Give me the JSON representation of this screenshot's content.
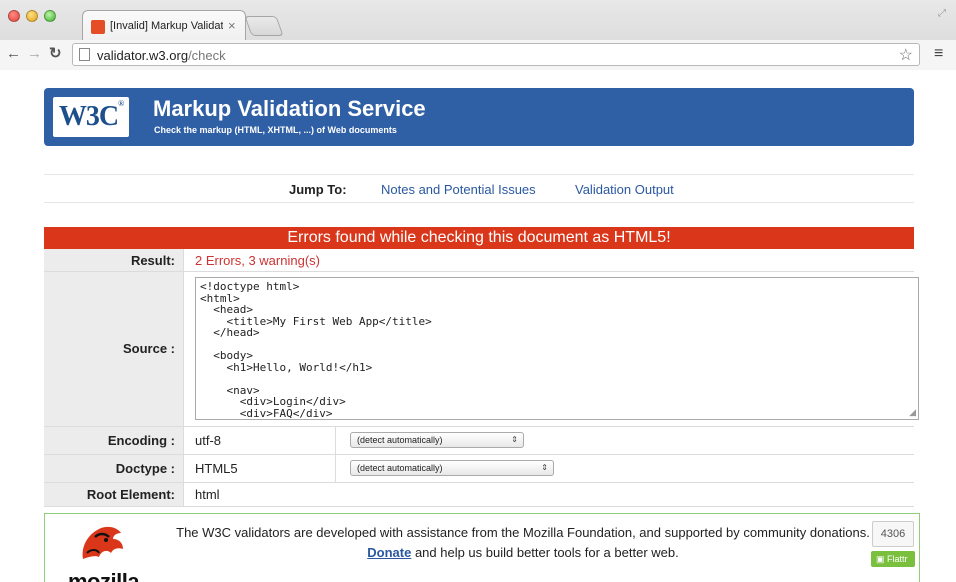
{
  "browser": {
    "tab_title": "[Invalid] Markup Validation",
    "tab_close": "×",
    "url_host": "validator.w3.org",
    "url_path": "/check"
  },
  "banner": {
    "logo_text": "W3C",
    "logo_mark": "®",
    "title": "Markup Validation Service",
    "subtitle": "Check the markup (HTML, XHTML, ...) of Web documents"
  },
  "jump": {
    "label": "Jump To:",
    "links": [
      "Notes and Potential Issues",
      "Validation Output"
    ]
  },
  "result_header": "Errors found while checking this document as HTML5!",
  "form": {
    "result_label": "Result:",
    "result_value": "2 Errors, 3 warning(s)",
    "source_label": "Source :",
    "source_code": "<!doctype html>\n<html>\n  <head>\n    <title>My First Web App</title>\n  </head>\n\n  <body>\n    <h1>Hello, World!</h1>\n\n    <nav>\n      <div>Login</div>\n      <div>FAQ</div>\n      <div>About</div>",
    "encoding_label": "Encoding :",
    "encoding_value": "utf-8",
    "encoding_select": "(detect automatically)",
    "doctype_label": "Doctype :",
    "doctype_value": "HTML5",
    "doctype_select": "(detect automatically)",
    "root_label": "Root Element:",
    "root_value": "html"
  },
  "sponsor": {
    "brand": "mozilla",
    "text_line1": "The W3C validators are developed with assistance from the Mozilla Foundation, and supported by community donations.",
    "donate_link": "Donate",
    "text_line2_rest": " and help us build better tools for a better web.",
    "counter": "4306",
    "flattr_label": "Flattr"
  },
  "colors": {
    "banner": "#2f5fa5",
    "error_header": "#d9361a",
    "link": "#2a58a0"
  },
  "icons": [
    "back-icon",
    "forward-icon",
    "reload-icon",
    "page-icon",
    "star-icon",
    "menu-icon",
    "close-icon",
    "dropdown-arrow-icon"
  ]
}
